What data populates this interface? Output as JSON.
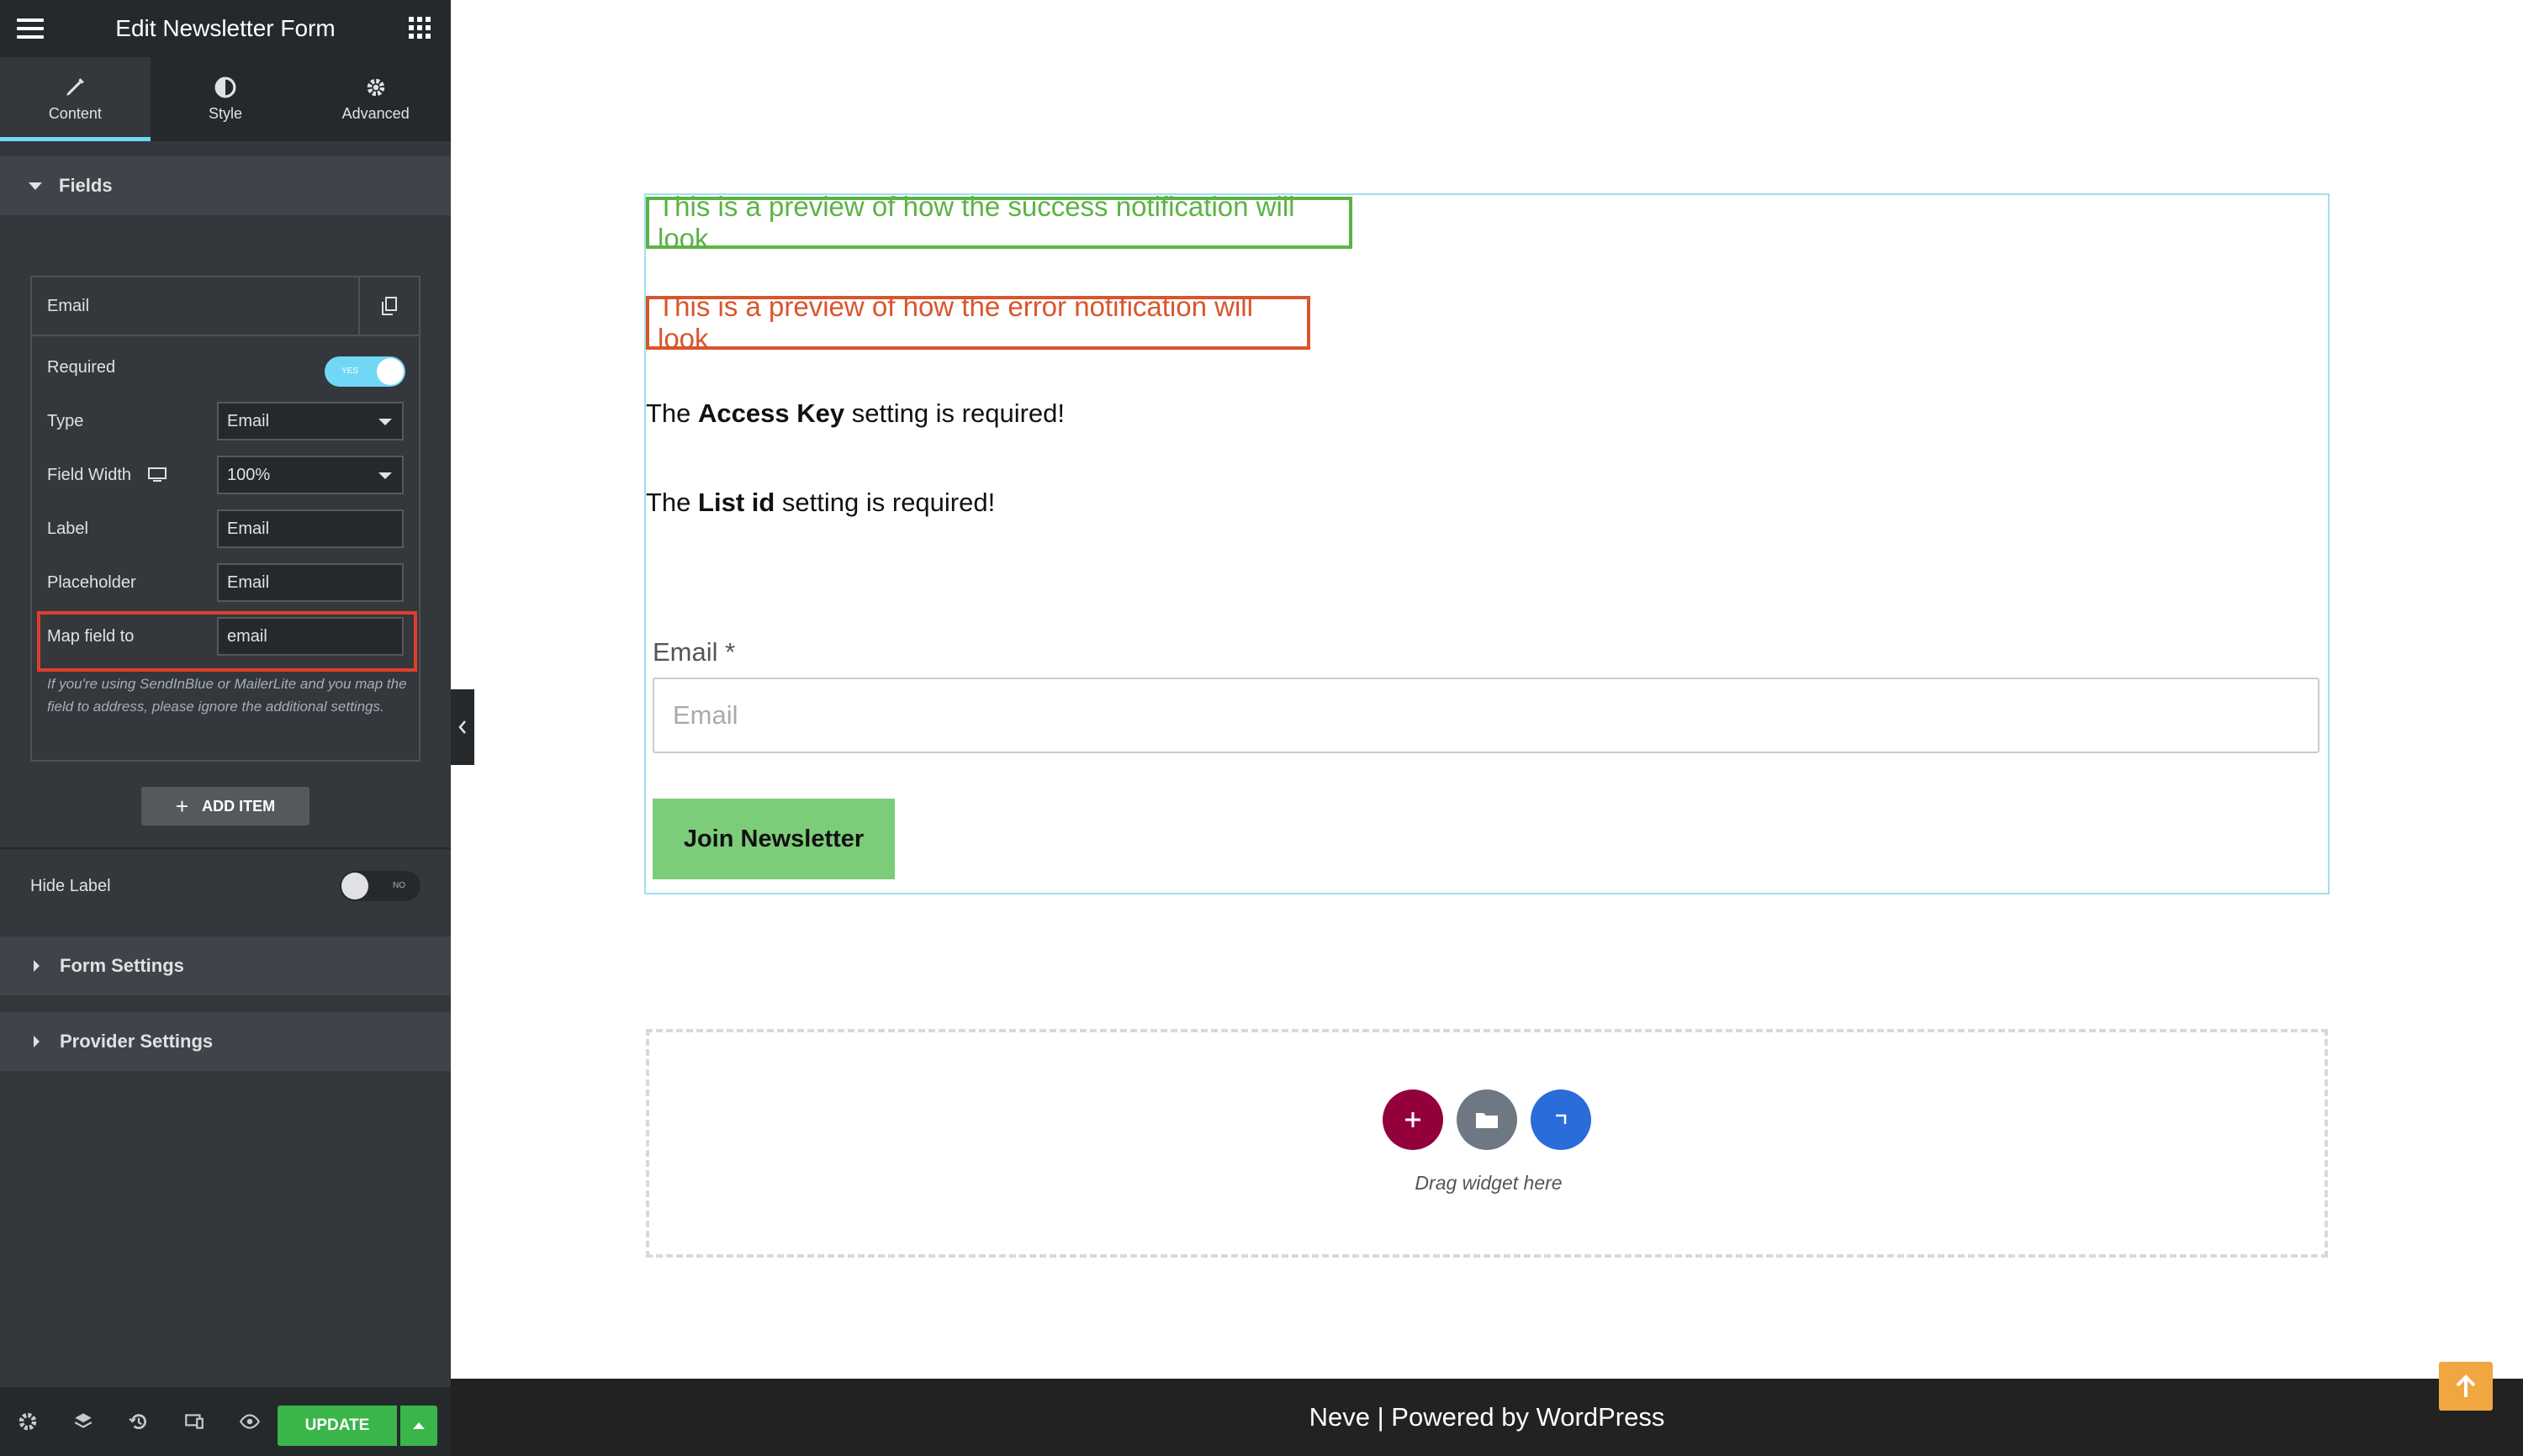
{
  "sidebar": {
    "title": "Edit Newsletter Form",
    "tabs": [
      {
        "label": "Content",
        "icon": "pencil-icon",
        "active": true
      },
      {
        "label": "Style",
        "icon": "half-circle-icon",
        "active": false
      },
      {
        "label": "Advanced",
        "icon": "gear-icon",
        "active": false
      }
    ],
    "fields_section": "Fields",
    "item": {
      "title": "Email",
      "required_label": "Required",
      "required_toggle": "YES",
      "type_label": "Type",
      "type_value": "Email",
      "width_label": "Field Width",
      "width_value": "100%",
      "label_label": "Label",
      "label_value": "Email",
      "placeholder_label": "Placeholder",
      "placeholder_value": "Email",
      "map_label": "Map field to",
      "map_value": "email",
      "help_text": "If you're using SendInBlue or MailerLite and you map the field to address, please ignore the additional settings."
    },
    "add_item": "ADD ITEM",
    "hide_label": "Hide Label",
    "hide_toggle": "NO",
    "form_settings": "Form Settings",
    "provider_settings": "Provider Settings",
    "update": "UPDATE",
    "accent_color": "#71d7f7",
    "update_color": "#39b54a"
  },
  "preview": {
    "success_msg": "This is a preview of how the success notification will look",
    "error_msg": "This is a preview of how the error notification will look",
    "access_key": {
      "pre": "The ",
      "bold": "Access Key",
      "post": " setting is required!"
    },
    "list_id": {
      "pre": "The ",
      "bold": "List id",
      "post": " setting is required!"
    },
    "email_label": "Email *",
    "email_placeholder": "Email",
    "button": "Join Newsletter",
    "drag_text": "Drag widget here",
    "success_color": "#5bb343",
    "error_color": "#d9552c",
    "button_color": "#7ccd79"
  },
  "footer": {
    "text": "Neve | Powered by WordPress"
  }
}
